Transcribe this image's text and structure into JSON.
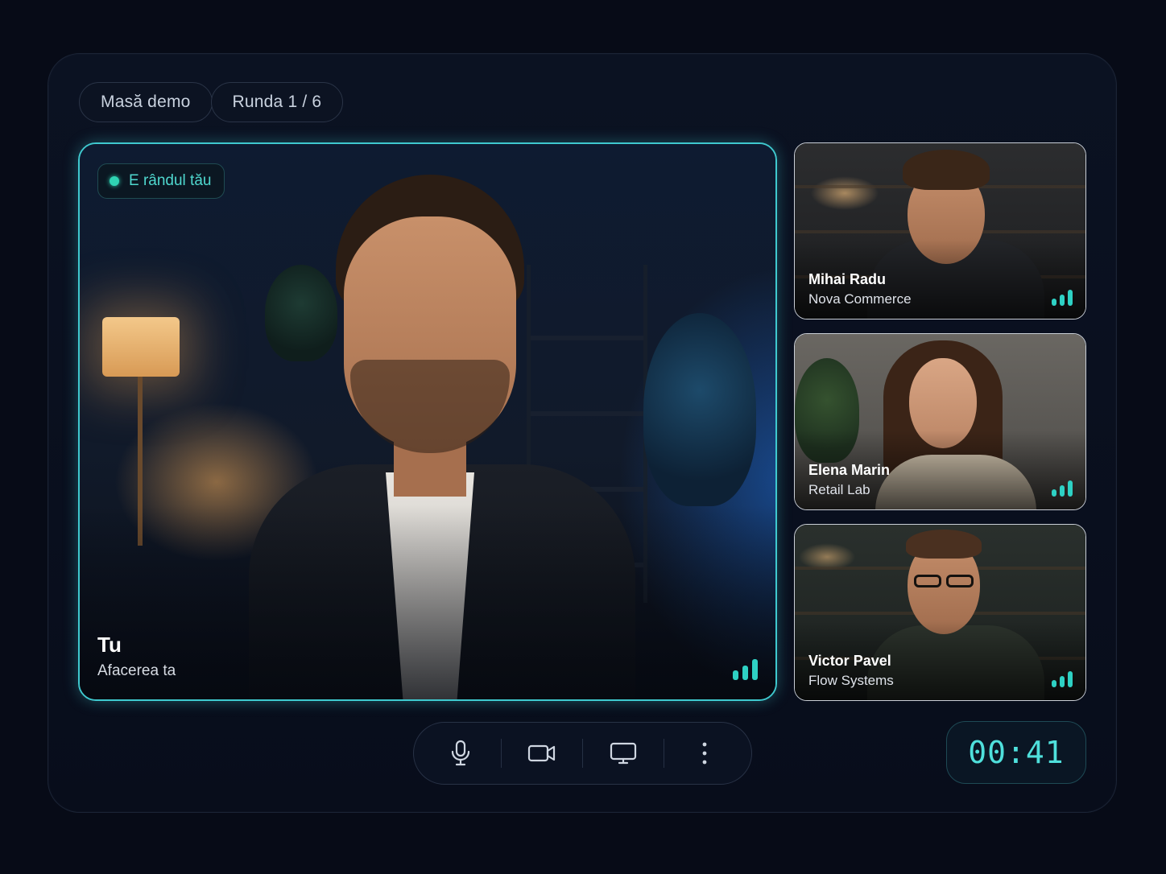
{
  "header": {
    "table_label": "Masă demo",
    "round_label": "Runda 1 / 6"
  },
  "main_participant": {
    "turn_badge": "E rândul tău",
    "name": "Tu",
    "company": "Afacerea ta",
    "signal_icon": "signal-bars-icon"
  },
  "participants": [
    {
      "name": "Mihai Radu",
      "company": "Nova Commerce"
    },
    {
      "name": "Elena Marin",
      "company": "Retail Lab"
    },
    {
      "name": "Victor Pavel",
      "company": "Flow Systems"
    }
  ],
  "controls": {
    "icons": [
      "microphone-icon",
      "camera-icon",
      "screen-share-icon",
      "more-vertical-icon"
    ]
  },
  "timer": {
    "value": "00:41"
  },
  "colors": {
    "accent": "#3fc9cf",
    "signal": "#2ed1c4",
    "background": "#070b17"
  }
}
